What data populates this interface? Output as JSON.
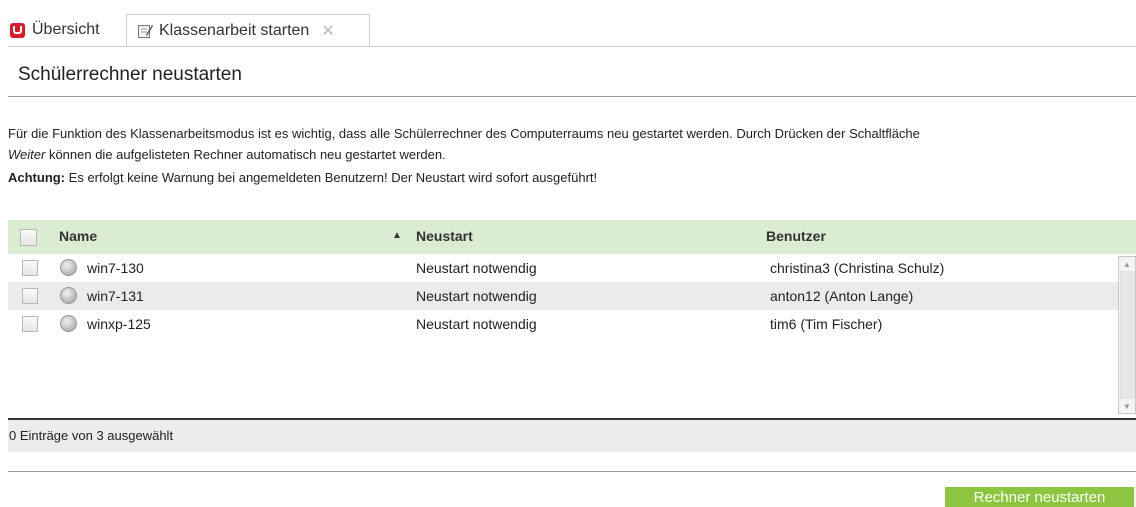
{
  "tabs": {
    "overview": "Übersicht",
    "active": "Klassenarbeit starten",
    "close_glyph": "✕"
  },
  "header": {
    "title": "Schülerrechner neustarten"
  },
  "description": {
    "line1": "Für die Funktion des Klassenarbeitsmodus ist es wichtig, dass alle Schülerrechner des Computerraums neu gestartet werden. Durch Drücken der Schaltfläche",
    "line2_em": "Weiter",
    "line2_rest": " können die aufgelisteten Rechner automatisch neu gestartet werden.",
    "warning_label": "Achtung:",
    "warning_text": " Es erfolgt keine Warnung bei angemeldeten Benutzern! Der Neustart wird sofort ausgeführt!"
  },
  "grid": {
    "columns": {
      "name": "Name",
      "restart": "Neustart",
      "user": "Benutzer"
    },
    "sort_indicator": "▲",
    "rows": [
      {
        "name": "win7-130",
        "restart": "Neustart notwendig",
        "user": "christina3 (Christina Schulz)"
      },
      {
        "name": "win7-131",
        "restart": "Neustart notwendig",
        "user": "anton12 (Anton Lange)"
      },
      {
        "name": "winxp-125",
        "restart": "Neustart notwendig",
        "user": "tim6 (Tim Fischer)"
      }
    ],
    "footer": "0 Einträge von 3 ausgewählt"
  },
  "actions": {
    "restart_button": "Rechner neustarten"
  },
  "colors": {
    "accent": "#8cc63f",
    "header_bg": "#daecd1",
    "logo": "#d61c2c"
  }
}
